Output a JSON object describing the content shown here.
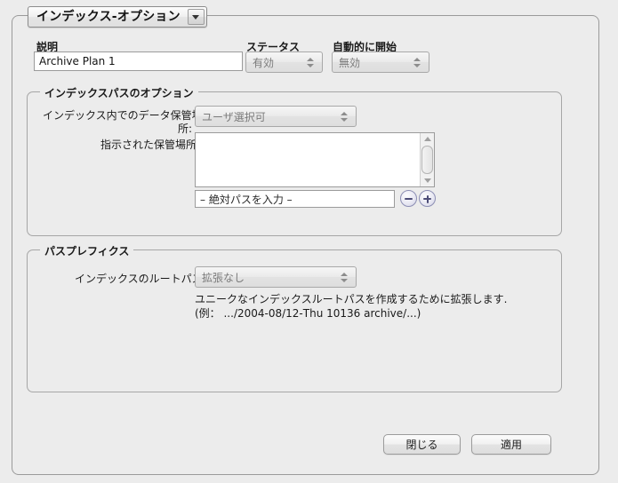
{
  "window": {
    "tab": {
      "label": "インデックス-オプション",
      "dropdown_icon": "chevron-down-icon"
    }
  },
  "top_fields": {
    "description": {
      "label": "説明",
      "value": "Archive Plan 1",
      "placeholder": ""
    },
    "status": {
      "label": "ステータス",
      "value": "有効"
    },
    "auto_start": {
      "label": "自動的に開始",
      "value": "無効"
    }
  },
  "index_path_group": {
    "title": "インデックスパスのオプション",
    "storage_location": {
      "label_line1": "インデックス内でのデータ保管場",
      "label_line2": "所:",
      "value": "ユーザ選択可"
    },
    "specified_location": {
      "label": "指示された保管場所:",
      "value": ""
    },
    "path_entry": {
      "value": "– 絶対パスを入力 –",
      "remove_button": "minus-icon",
      "add_button": "plus-icon"
    }
  },
  "path_prefix_group": {
    "title": "パスプレフィクス",
    "root_path": {
      "label": "インデックスのルートパス:",
      "value": "拡張なし"
    },
    "description_line1": "ユニークなインデックスルートパスを作成するために拡張します.",
    "description_line2": "(例： .../2004-08/12-Thu 10136 archive/...)"
  },
  "footer": {
    "close_label": "閉じる",
    "apply_label": "適用"
  },
  "colors": {
    "background": "#ececec",
    "frame_border": "#9a9a9a",
    "field_border": "#9b9b9b",
    "disabled_text": "#7b7b7b",
    "accent_circle": "#4c4c77"
  }
}
